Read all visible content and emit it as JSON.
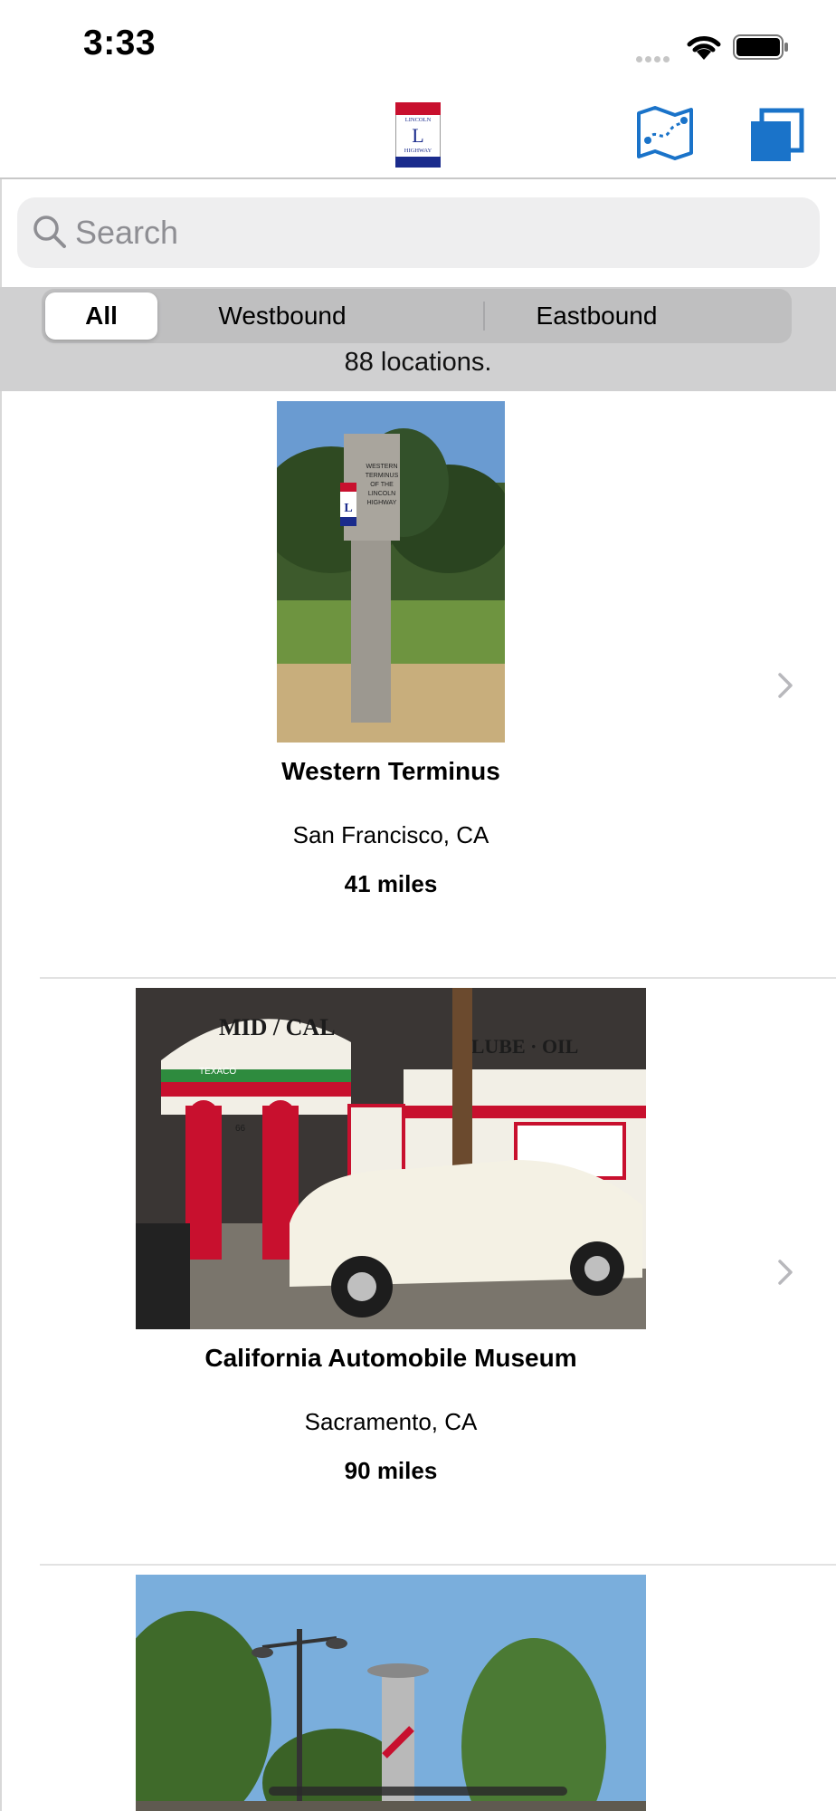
{
  "status_bar": {
    "time": "3:33"
  },
  "nav": {
    "logo_text": [
      "LINCOLN",
      "L",
      "HIGHWAY"
    ]
  },
  "search": {
    "placeholder": "Search",
    "value": ""
  },
  "segments": {
    "items": [
      "All",
      "Westbound",
      "Eastbound"
    ],
    "selected": "All"
  },
  "location_count": "88 locations.",
  "locations": [
    {
      "title": "Western Terminus",
      "location": "San Francisco, CA",
      "distance": "41 miles",
      "photo_sign_text": [
        "WESTERN",
        "TERMINUS",
        "OF THE",
        "LINCOLN",
        "HIGHWAY"
      ]
    },
    {
      "title": "California Automobile Museum",
      "location": "Sacramento, CA",
      "distance": "90 miles",
      "photo_sign_text": [
        "MID / CAL",
        "LUBE · OIL",
        "TEXACO",
        "66"
      ]
    },
    {
      "title": "",
      "location": "",
      "distance": ""
    }
  ],
  "colors": {
    "accent": "#1a73c9",
    "segment_bg": "#bfbfc0",
    "band": "#d0d0d1"
  }
}
